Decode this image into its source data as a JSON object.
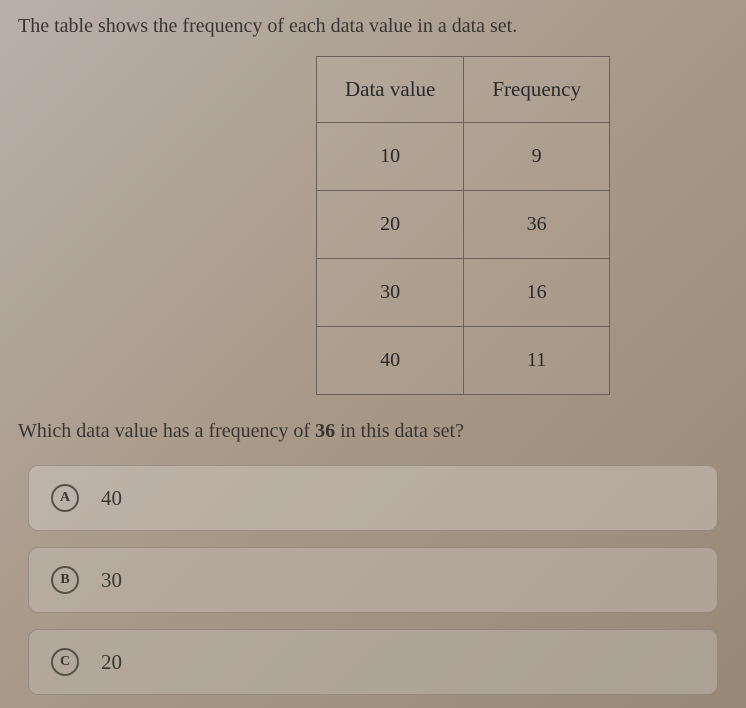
{
  "prompt": "The table shows the frequency of each data value in a data set.",
  "table": {
    "headers": [
      "Data value",
      "Frequency"
    ],
    "rows": [
      {
        "value": "10",
        "freq": "9"
      },
      {
        "value": "20",
        "freq": "36"
      },
      {
        "value": "30",
        "freq": "16"
      },
      {
        "value": "40",
        "freq": "11"
      }
    ]
  },
  "question_prefix": "Which data value has a frequency of ",
  "question_bold": "36",
  "question_suffix": " in this data set?",
  "options": [
    {
      "letter": "A",
      "value": "40"
    },
    {
      "letter": "B",
      "value": "30"
    },
    {
      "letter": "C",
      "value": "20"
    }
  ],
  "chart_data": {
    "type": "table",
    "title": "Frequency of each data value",
    "columns": [
      "Data value",
      "Frequency"
    ],
    "rows": [
      [
        10,
        9
      ],
      [
        20,
        36
      ],
      [
        30,
        16
      ],
      [
        40,
        11
      ]
    ]
  }
}
